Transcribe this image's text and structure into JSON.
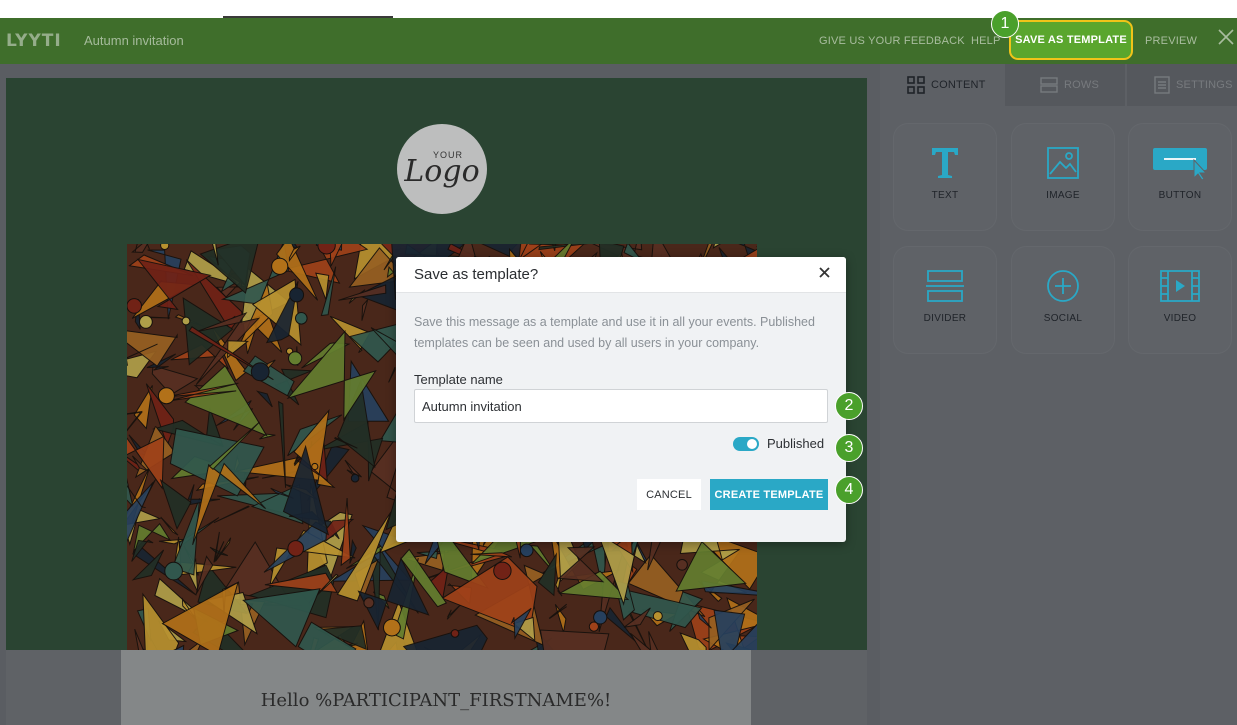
{
  "app": {
    "logo_text": "LYYTI",
    "document_title": "Autumn invitation"
  },
  "header": {
    "feedback_label": "GIVE US YOUR FEEDBACK",
    "help_label": "HELP",
    "save_template_label": "SAVE AS TEMPLATE",
    "preview_label": "PREVIEW",
    "close_icon": "close-icon"
  },
  "email": {
    "logo_top": "YOUR",
    "logo_main": "Logo",
    "greeting": "Hello %PARTICIPANT_FIRSTNAME%!"
  },
  "panel": {
    "tabs": [
      {
        "label": "CONTENT",
        "icon": "grid-icon",
        "active": true
      },
      {
        "label": "ROWS",
        "icon": "rows-icon",
        "active": false
      },
      {
        "label": "SETTINGS",
        "icon": "settings-icon",
        "active": false
      }
    ],
    "blocks": [
      {
        "label": "TEXT",
        "icon": "text-icon"
      },
      {
        "label": "IMAGE",
        "icon": "image-icon"
      },
      {
        "label": "BUTTON",
        "icon": "button-icon"
      },
      {
        "label": "DIVIDER",
        "icon": "divider-icon"
      },
      {
        "label": "SOCIAL",
        "icon": "social-icon"
      },
      {
        "label": "VIDEO",
        "icon": "video-icon"
      }
    ]
  },
  "modal": {
    "title": "Save as template?",
    "description": "Save this message as a template and use it in all your events. Published templates can be seen and used by all users in your company.",
    "field_label": "Template name",
    "field_value": "Autumn invitation",
    "toggle_label": "Published",
    "toggle_on": true,
    "cancel_label": "CANCEL",
    "create_label": "CREATE TEMPLATE"
  },
  "markers": [
    "1",
    "2",
    "3",
    "4"
  ],
  "colors": {
    "header_green": "#3f6e2b",
    "accent_teal": "#2aa8c6",
    "marker_green": "#4aa02b",
    "highlight_yellow": "#f0c419"
  }
}
